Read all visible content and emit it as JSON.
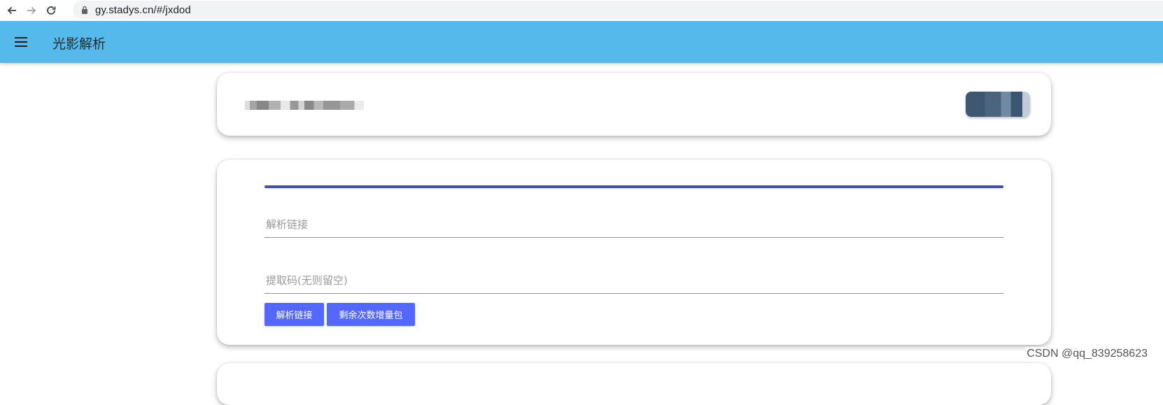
{
  "browser": {
    "url": "gy.stadys.cn/#/jxdod",
    "icons": [
      "back-arrow-icon",
      "forward-arrow-icon",
      "reload-icon",
      "lock-icon"
    ]
  },
  "app_bar": {
    "title": "光影解析",
    "menu_icon": "hamburger-menu-icon",
    "background_color": "#55b9ec"
  },
  "main": {
    "progress": 1.0,
    "progress_color": "#3f51b5",
    "link_field": {
      "placeholder": "解析链接",
      "value": ""
    },
    "code_field": {
      "placeholder": "提取码(无则留空)",
      "value": ""
    },
    "parse_button": "解析链接",
    "buy_button": "剩余次数增量包",
    "button_color": "#5468ff"
  },
  "watermark": "CSDN @qq_839258623"
}
